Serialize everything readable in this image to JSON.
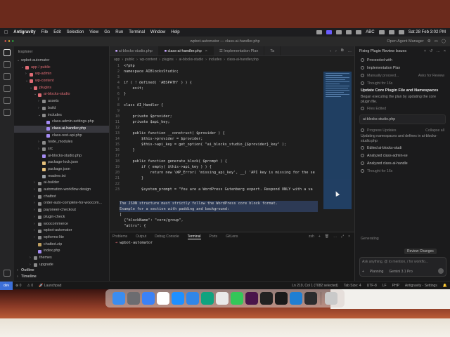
{
  "menubar": {
    "app": "Antigravity",
    "items": [
      "File",
      "Edit",
      "Selection",
      "View",
      "Go",
      "Run",
      "Terminal",
      "Window",
      "Help"
    ],
    "input_source": "ABC",
    "clock": "Sat 28 Feb  3:02 PM"
  },
  "window": {
    "title": "wpbot-automator — class-ai-handler.php",
    "open_agent_manager": "Open Agent Manager"
  },
  "explorer": {
    "header": "Explorer",
    "root": "wpbot-automator",
    "items": [
      {
        "label": "app / public",
        "depth": 1,
        "kind": "folder-red",
        "open": true
      },
      {
        "label": "wp-admin",
        "depth": 2,
        "kind": "folder-red",
        "open": false
      },
      {
        "label": "wp-content",
        "depth": 2,
        "kind": "folder-red",
        "open": true
      },
      {
        "label": "plugins",
        "depth": 3,
        "kind": "folder-red",
        "open": true
      },
      {
        "label": "ai-blocks-studio",
        "depth": 4,
        "kind": "folder-red",
        "open": true
      },
      {
        "label": "assets",
        "depth": 5,
        "kind": "folder",
        "open": false
      },
      {
        "label": "build",
        "depth": 5,
        "kind": "folder",
        "open": false
      },
      {
        "label": "includes",
        "depth": 5,
        "kind": "folder",
        "open": true
      },
      {
        "label": "class-admin-settings.php",
        "depth": 6,
        "kind": "php"
      },
      {
        "label": "class-ai-handler.php",
        "depth": 6,
        "kind": "php",
        "selected": true
      },
      {
        "label": "class-rest-api.php",
        "depth": 6,
        "kind": "php"
      },
      {
        "label": "node_modules",
        "depth": 5,
        "kind": "folder",
        "open": false
      },
      {
        "label": "src",
        "depth": 5,
        "kind": "folder",
        "open": false
      },
      {
        "label": "ai-blocks-studio.php",
        "depth": 5,
        "kind": "php"
      },
      {
        "label": "package-lock.json",
        "depth": 5,
        "kind": "json"
      },
      {
        "label": "package.json",
        "depth": 5,
        "kind": "json"
      },
      {
        "label": "readme.txt",
        "depth": 5,
        "kind": "txt"
      },
      {
        "label": "ai-builder",
        "depth": 4,
        "kind": "folder",
        "open": false
      },
      {
        "label": "automation-workflow-design",
        "depth": 4,
        "kind": "folder",
        "open": false
      },
      {
        "label": "chatbot",
        "depth": 4,
        "kind": "folder",
        "open": false
      },
      {
        "label": "order-auto-complete-for-woocom...",
        "depth": 4,
        "kind": "folder",
        "open": false
      },
      {
        "label": "payoneer-checkout",
        "depth": 4,
        "kind": "folder",
        "open": false
      },
      {
        "label": "plugin-check",
        "depth": 4,
        "kind": "folder",
        "open": false
      },
      {
        "label": "woocommerce",
        "depth": 4,
        "kind": "folder",
        "open": false
      },
      {
        "label": "wpbot-automator",
        "depth": 4,
        "kind": "folder",
        "open": false
      },
      {
        "label": "wpforms-lite",
        "depth": 4,
        "kind": "folder",
        "open": false
      },
      {
        "label": "chatbot.zip",
        "depth": 4,
        "kind": "zip"
      },
      {
        "label": "index.php",
        "depth": 4,
        "kind": "php"
      },
      {
        "label": "themes",
        "depth": 3,
        "kind": "folder",
        "open": false
      },
      {
        "label": "upgrade",
        "depth": 3,
        "kind": "folder",
        "open": false
      }
    ],
    "outline": "Outline",
    "timeline": "Timeline"
  },
  "editor": {
    "tabs": [
      {
        "label": "ai-blocks-studio.php",
        "active": false
      },
      {
        "label": "class-ai-handler.php",
        "active": true
      },
      {
        "label": "Implementation Plan",
        "active": false
      },
      {
        "label": "Ta",
        "active": false
      }
    ],
    "breadcrumb": [
      "app",
      "public",
      "wp-content",
      "plugins",
      "ai-blocks-studio",
      "includes",
      "class-ai-handler.php"
    ],
    "lines": [
      {
        "n": "1",
        "text": "<?php"
      },
      {
        "n": "2",
        "text": "namespace AIBlocksStudio;"
      },
      {
        "n": "3",
        "text": ""
      },
      {
        "n": "4",
        "text": "if ( ! defined( 'ABSPATH' ) ) {"
      },
      {
        "n": "5",
        "text": "    exit;"
      },
      {
        "n": "6",
        "text": "}"
      },
      {
        "n": "7",
        "text": ""
      },
      {
        "n": "8",
        "text": "class AI_Handler {"
      },
      {
        "n": "9",
        "text": ""
      },
      {
        "n": "10",
        "text": "    private $provider;"
      },
      {
        "n": "11",
        "text": "    private $api_key;"
      },
      {
        "n": "12",
        "text": ""
      },
      {
        "n": "13",
        "text": "    public function __construct( $provider ) {"
      },
      {
        "n": "14",
        "text": "        $this->provider = $provider;"
      },
      {
        "n": "15",
        "text": "        $this->api_key = get_option( \"ai_blocks_studio_{$provider}_key\" );"
      },
      {
        "n": "16",
        "text": "    }"
      },
      {
        "n": "17",
        "text": ""
      },
      {
        "n": "18",
        "text": "    public function generate_block( $prompt ) {"
      },
      {
        "n": "19",
        "text": "        if ( empty( $this->api_key ) ) {"
      },
      {
        "n": "20",
        "text": "            return new \\WP_Error( 'missing_api_key', __( 'API key is missing for the se"
      },
      {
        "n": "21",
        "text": "        }"
      },
      {
        "n": "22",
        "text": ""
      },
      {
        "n": "23",
        "text": "        $system_prompt = \"You are a WordPress Gutenberg expert. Respond ONLY with a va"
      }
    ],
    "popup_lines": [
      "The JSON structure must strictly follow the WordPress core block format.",
      "Example for a section with padding and background:",
      "[",
      "  {\"blockName\": \"core/group\",",
      "  \"attrs\": {"
    ]
  },
  "panel": {
    "tabs": [
      "Problems",
      "Output",
      "Debug Console",
      "Terminal",
      "Ports",
      "GitLens"
    ],
    "active_tab": "Terminal",
    "shell": "zsh",
    "term_line": "wpbot-automator"
  },
  "agent": {
    "header": "Fixing Plugin Review Issues",
    "items": [
      {
        "type": "row",
        "label": "Proceeded with"
      },
      {
        "type": "row",
        "label": "Implementation Plan"
      },
      {
        "type": "row-split",
        "label": "Manually proceed...",
        "right": "Asks for Review",
        "muted": true
      },
      {
        "type": "row",
        "label": "Thought for 16s",
        "muted": true
      },
      {
        "type": "title",
        "label": "Update Core Plugin File and Namespaces"
      },
      {
        "type": "text",
        "label": "Began executing the plan by updating the core plugin file."
      },
      {
        "type": "row",
        "label": "Files Edited",
        "muted": true
      },
      {
        "type": "card",
        "label": "ai-blocks-studio.php"
      },
      {
        "type": "row-split",
        "label": "Progress Updates",
        "right": "Collapse all",
        "muted": true
      },
      {
        "type": "text",
        "label": "Updating namespaces and defines in ai-blocks-studio.php"
      },
      {
        "type": "row",
        "label": "Edited  ai-blocks-studi"
      },
      {
        "type": "row",
        "label": "Analyzed  class-admin-se"
      },
      {
        "type": "row",
        "label": "Analyzed  class-ai-handle"
      },
      {
        "type": "row",
        "label": "Thought for 16s",
        "muted": true
      }
    ],
    "generating": "Generating",
    "review_changes": "Review Changes",
    "input_placeholder": "Ask anything, @ to mention, / for workflo...",
    "mode": "Planning",
    "model": "Gemini 3.1 Pro"
  },
  "statusbar": {
    "remote": "dev",
    "errors": "0",
    "warnings": "0",
    "launchpad": "Launchpad",
    "position": "Ln 219, Col 1 (7082 selected)",
    "tabsize": "Tab Size: 4",
    "encoding": "UTF-8",
    "eol": "LF",
    "lang": "PHP",
    "settings": "Antigravity - Settings"
  },
  "dock": {
    "apps": [
      {
        "name": "finder",
        "color": "#3b8df0"
      },
      {
        "name": "launchpad",
        "color": "#6c6c70"
      },
      {
        "name": "mail",
        "color": "#3b82f6"
      },
      {
        "name": "calendar",
        "color": "#ffffff"
      },
      {
        "name": "app-store",
        "color": "#1e90ff"
      },
      {
        "name": "safari",
        "color": "#2f86e8"
      },
      {
        "name": "chatgpt",
        "color": "#10a37f"
      },
      {
        "name": "chrome",
        "color": "#e9e9e9"
      },
      {
        "name": "messages",
        "color": "#34c759"
      },
      {
        "name": "slack",
        "color": "#4a154b"
      },
      {
        "name": "figma",
        "color": "#222222"
      },
      {
        "name": "terminal",
        "color": "#1a1a1a"
      },
      {
        "name": "vscode",
        "color": "#1f7fd3"
      },
      {
        "name": "antigravity",
        "color": "#2c2c2e"
      },
      {
        "name": "trash",
        "color": "#c9c9c9"
      }
    ]
  }
}
